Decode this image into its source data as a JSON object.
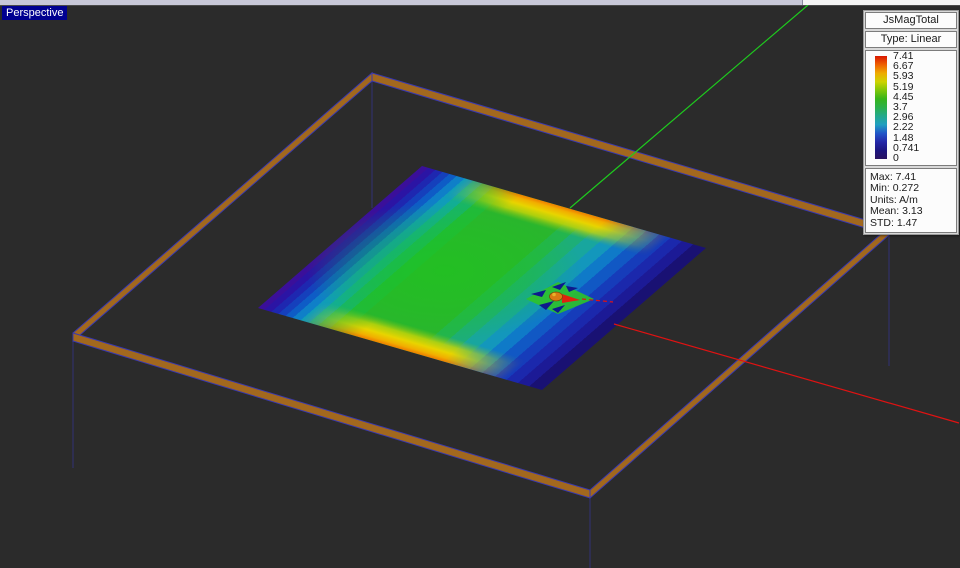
{
  "window": {
    "view_label": "Perspective"
  },
  "legend": {
    "title": "JsMagTotal",
    "type_label": "Type: Linear",
    "ticks": [
      "7.41",
      "6.67",
      "5.93",
      "5.19",
      "4.45",
      "3.7",
      "2.96",
      "2.22",
      "1.48",
      "0.741",
      "0"
    ],
    "stats": [
      "Max: 7.41",
      "Min: 0.272",
      "Units: A/m",
      "Mean: 3.13",
      "STD: 1.47"
    ],
    "colorbar_gradient": [
      "#d81600",
      "#ee5f00",
      "#eeaa00",
      "#cdd300",
      "#7ec609",
      "#36b41a",
      "#2bb04b",
      "#23a98c",
      "#1f9fc0",
      "#2056c8",
      "#2428a8",
      "#1c1580",
      "#2a1260"
    ]
  },
  "colors": {
    "background": "#2b2b2b",
    "substrate_edge": "#a2681e",
    "outline": "#3939b0",
    "axis_y_green": "#1ecb1e",
    "axis_x_red": "#e01212",
    "selection_bg": "#000090"
  }
}
